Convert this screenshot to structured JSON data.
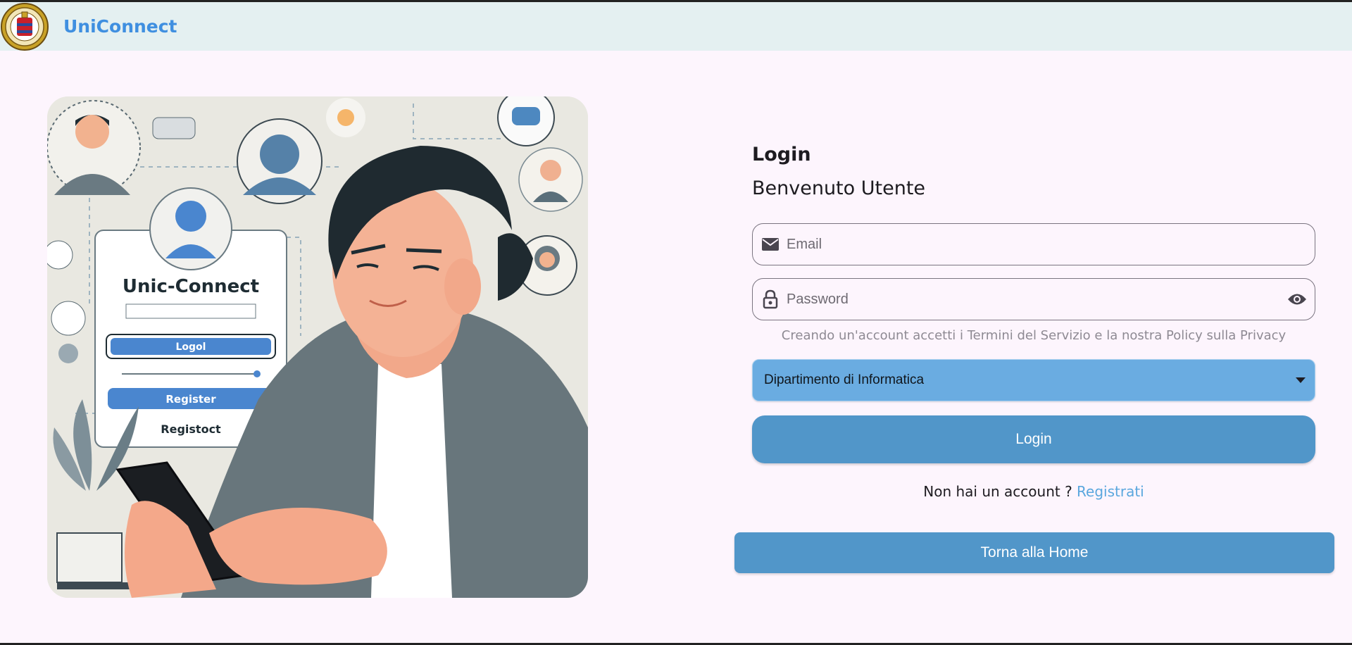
{
  "appbar": {
    "brand": "UniConnect",
    "logo_icon": "university-seal-icon"
  },
  "hero": {
    "illustration": "person-using-phone-login-illustration",
    "card_title": "Unic-Connect",
    "card_btn_primary": "Logol",
    "card_btn_secondary": "Register",
    "card_link": "Registoct"
  },
  "form": {
    "title": "Login",
    "subtitle": "Benvenuto Utente",
    "email_placeholder": "Email",
    "password_placeholder": "Password",
    "terms_text": "Creando un'account accetti i Termini del Servizio e la nostra Policy sulla Privacy",
    "department_selected": "Dipartimento di Informatica",
    "login_label": "Login",
    "signup_prompt": "Non hai un account ? ",
    "signup_link": "Registrati",
    "home_label": "Torna alla Home"
  },
  "colors": {
    "appbar_bg": "#e4f0f1",
    "brand": "#3f8fe0",
    "page_bg": "#fdf5fd",
    "primary_button": "#5196c9",
    "dropdown_bg": "#6aace1",
    "link": "#5aa7de"
  }
}
